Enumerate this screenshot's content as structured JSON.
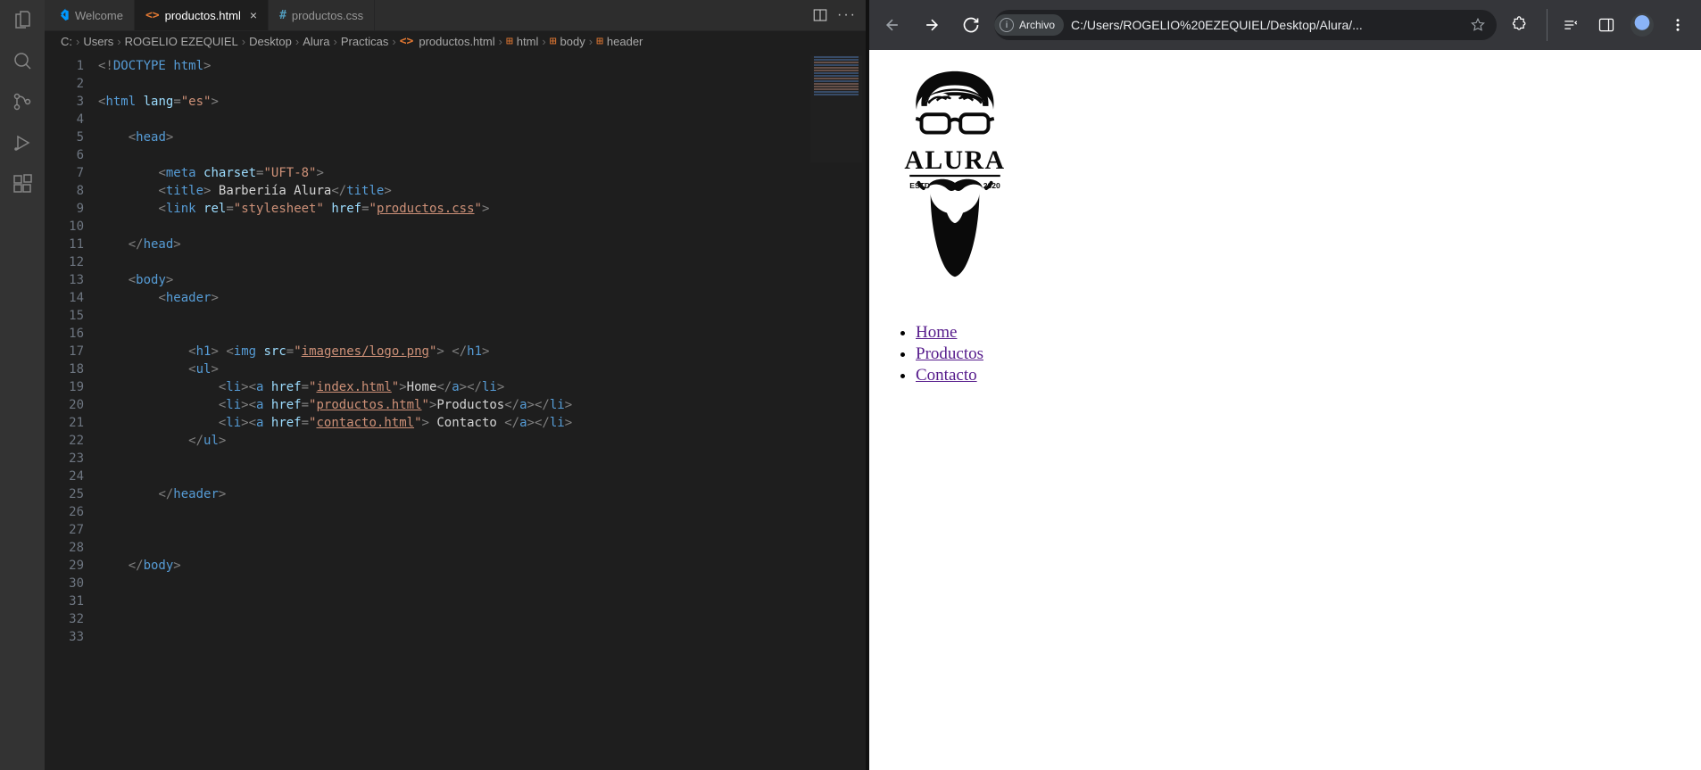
{
  "vscode": {
    "tabs": [
      {
        "icon": "vscode",
        "label": "Welcome",
        "active": false,
        "closable": false
      },
      {
        "icon": "html",
        "label": "productos.html",
        "active": true,
        "closable": true
      },
      {
        "icon": "css",
        "label": "productos.css",
        "active": false,
        "closable": false
      }
    ],
    "breadcrumbs": [
      "C:",
      "Users",
      "ROGELIO EZEQUIEL",
      "Desktop",
      "Alura",
      "Practicas",
      "productos.html",
      "html",
      "body",
      "header"
    ],
    "code_lines": [
      {
        "n": 1,
        "html": "<span class='pun'>&lt;!</span><span class='doct'>DOCTYPE</span> <span class='tagn'>html</span><span class='pun'>&gt;</span>"
      },
      {
        "n": 2,
        "html": ""
      },
      {
        "n": 3,
        "html": "<span class='pun'>&lt;</span><span class='tagn'>html</span> <span class='attr'>lang</span><span class='pun'>=</span><span class='str'>\"es\"</span><span class='pun'>&gt;</span>"
      },
      {
        "n": 4,
        "html": ""
      },
      {
        "n": 5,
        "html": "    <span class='pun'>&lt;</span><span class='tagn'>head</span><span class='pun'>&gt;</span>"
      },
      {
        "n": 6,
        "html": ""
      },
      {
        "n": 7,
        "html": "        <span class='pun'>&lt;</span><span class='tagn'>meta</span> <span class='attr'>charset</span><span class='pun'>=</span><span class='str'>\"UFT-8\"</span><span class='pun'>&gt;</span>"
      },
      {
        "n": 8,
        "html": "        <span class='pun'>&lt;</span><span class='tagn'>title</span><span class='pun'>&gt;</span> Barberiía Alura<span class='pun'>&lt;/</span><span class='tagn'>title</span><span class='pun'>&gt;</span>"
      },
      {
        "n": 9,
        "html": "        <span class='pun'>&lt;</span><span class='tagn'>link</span> <span class='attr'>rel</span><span class='pun'>=</span><span class='str'>\"stylesheet\"</span> <span class='attr'>href</span><span class='pun'>=</span><span class='str'>\"</span><span class='link-str'>productos.css</span><span class='str'>\"</span><span class='pun'>&gt;</span>"
      },
      {
        "n": 10,
        "html": ""
      },
      {
        "n": 11,
        "html": "    <span class='pun'>&lt;/</span><span class='tagn'>head</span><span class='pun'>&gt;</span>"
      },
      {
        "n": 12,
        "html": ""
      },
      {
        "n": 13,
        "html": "    <span class='pun'>&lt;</span><span class='tagn'>body</span><span class='pun'>&gt;</span>"
      },
      {
        "n": 14,
        "html": "        <span class='pun'>&lt;</span><span class='tagn'>header</span><span class='pun'>&gt;</span>"
      },
      {
        "n": 15,
        "html": ""
      },
      {
        "n": 16,
        "html": ""
      },
      {
        "n": 17,
        "html": "            <span class='pun'>&lt;</span><span class='tagn'>h1</span><span class='pun'>&gt;</span> <span class='pun'>&lt;</span><span class='tagn'>img</span> <span class='attr'>src</span><span class='pun'>=</span><span class='str'>\"</span><span class='link-str'>imagenes/logo.png</span><span class='str'>\"</span><span class='pun'>&gt;</span> <span class='pun'>&lt;/</span><span class='tagn'>h1</span><span class='pun'>&gt;</span>"
      },
      {
        "n": 18,
        "html": "            <span class='pun'>&lt;</span><span class='tagn'>ul</span><span class='pun'>&gt;</span>"
      },
      {
        "n": 19,
        "html": "                <span class='pun'>&lt;</span><span class='tagn'>li</span><span class='pun'>&gt;&lt;</span><span class='tagn'>a</span> <span class='attr'>href</span><span class='pun'>=</span><span class='str'>\"</span><span class='link-str'>index.html</span><span class='str'>\"</span><span class='pun'>&gt;</span>Home<span class='pun'>&lt;/</span><span class='tagn'>a</span><span class='pun'>&gt;&lt;/</span><span class='tagn'>li</span><span class='pun'>&gt;</span>"
      },
      {
        "n": 20,
        "html": "                <span class='pun'>&lt;</span><span class='tagn'>li</span><span class='pun'>&gt;&lt;</span><span class='tagn'>a</span> <span class='attr'>href</span><span class='pun'>=</span><span class='str'>\"</span><span class='link-str'>productos.html</span><span class='str'>\"</span><span class='pun'>&gt;</span>Productos<span class='pun'>&lt;/</span><span class='tagn'>a</span><span class='pun'>&gt;&lt;/</span><span class='tagn'>li</span><span class='pun'>&gt;</span>"
      },
      {
        "n": 21,
        "html": "                <span class='pun'>&lt;</span><span class='tagn'>li</span><span class='pun'>&gt;&lt;</span><span class='tagn'>a</span> <span class='attr'>href</span><span class='pun'>=</span><span class='str'>\"</span><span class='link-str'>contacto.html</span><span class='str'>\"</span><span class='pun'>&gt;</span> Contacto <span class='pun'>&lt;/</span><span class='tagn'>a</span><span class='pun'>&gt;&lt;/</span><span class='tagn'>li</span><span class='pun'>&gt;</span>"
      },
      {
        "n": 22,
        "html": "            <span class='pun'>&lt;/</span><span class='tagn'>ul</span><span class='pun'>&gt;</span>"
      },
      {
        "n": 23,
        "html": ""
      },
      {
        "n": 24,
        "html": ""
      },
      {
        "n": 25,
        "html": "        <span class='pun'>&lt;/</span><span class='tagn'>header</span><span class='pun'>&gt;</span>"
      },
      {
        "n": 26,
        "html": ""
      },
      {
        "n": 27,
        "html": ""
      },
      {
        "n": 28,
        "html": ""
      },
      {
        "n": 29,
        "html": "    <span class='pun'>&lt;/</span><span class='tagn'>body</span><span class='pun'>&gt;</span>"
      },
      {
        "n": 30,
        "html": ""
      },
      {
        "n": 31,
        "html": ""
      },
      {
        "n": 32,
        "html": ""
      },
      {
        "n": 33,
        "html": ""
      }
    ]
  },
  "chrome": {
    "security_label": "Archivo",
    "url": "C:/Users/ROGELIO%20EZEQUIEL/Desktop/Alura/...",
    "nav": {
      "home": "Home",
      "productos": "Productos",
      "contacto": "Contacto"
    },
    "logo": {
      "text": "ALURA",
      "estd": "ESTD",
      "year": "2020"
    }
  }
}
